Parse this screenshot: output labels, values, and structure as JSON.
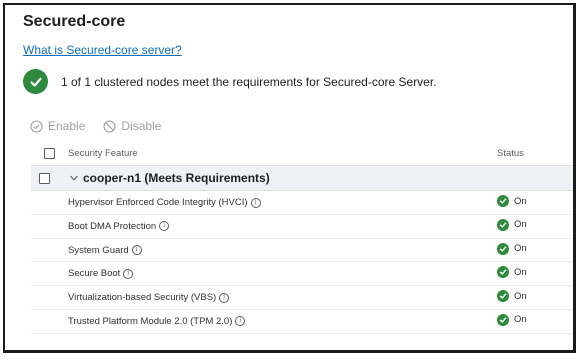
{
  "page": {
    "title": "Secured-core",
    "help_link": "What is Secured-core server?",
    "summary": "1 of 1 clustered nodes meet the requirements for Secured-core Server."
  },
  "toolbar": {
    "enable_label": "Enable",
    "disable_label": "Disable"
  },
  "table": {
    "columns": [
      "Security Feature",
      "Status"
    ],
    "group": {
      "label": "cooper-n1 (Meets Requirements)"
    },
    "rows": [
      {
        "feature": "Hypervisor Enforced Code Integrity (HVCI)",
        "status": "On"
      },
      {
        "feature": "Boot DMA Protection",
        "status": "On"
      },
      {
        "feature": "System Guard",
        "status": "On"
      },
      {
        "feature": "Secure Boot",
        "status": "On"
      },
      {
        "feature": "Virtualization-based Security (VBS)",
        "status": "On"
      },
      {
        "feature": "Trusted Platform Module 2.0 (TPM 2.0)",
        "status": "On"
      }
    ]
  },
  "colors": {
    "success": "#2e8b3d",
    "link": "#0f6cbd",
    "group_bg": "#eef1f6",
    "disabled_text": "#a19f9d"
  },
  "icons": {
    "summary": "check-circle-icon",
    "enable": "check-circle-outline-icon",
    "disable": "prohibited-icon",
    "expand": "chevron-down-icon",
    "info": "info-icon",
    "status": "check-circle-icon"
  }
}
